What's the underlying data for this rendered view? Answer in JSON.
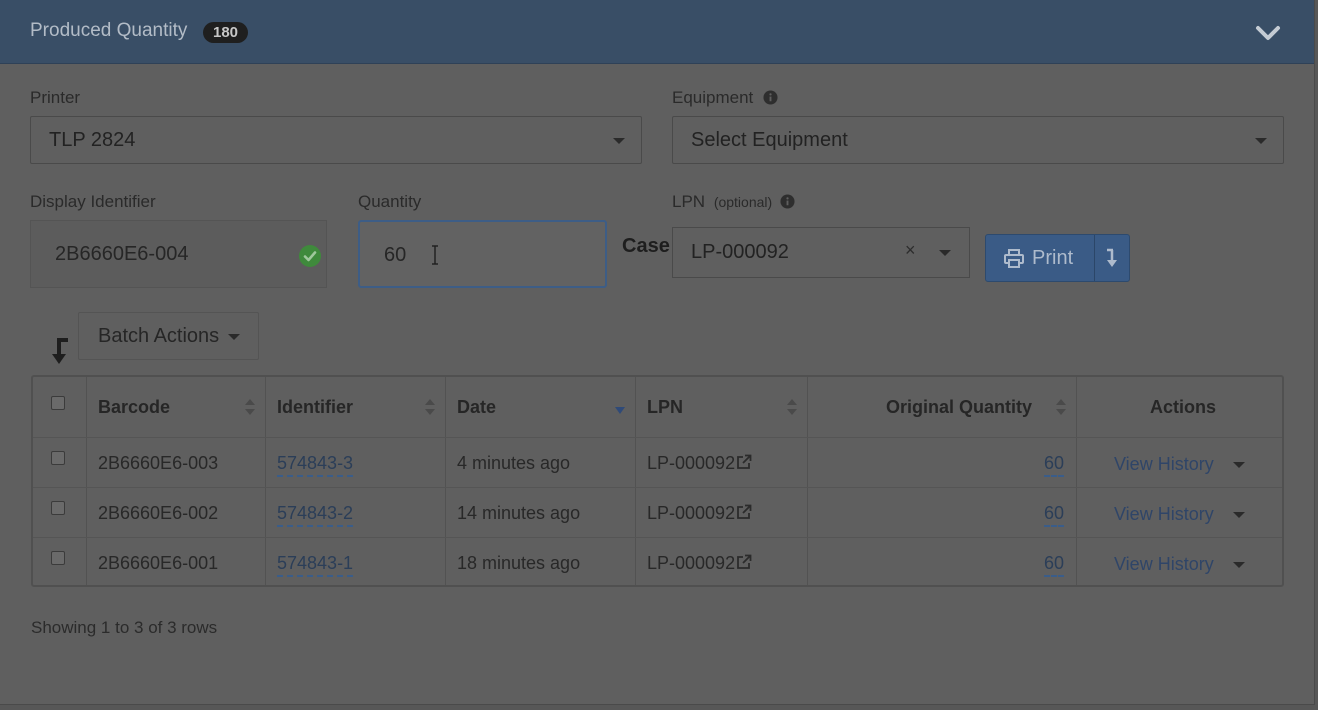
{
  "panel": {
    "title": "Produced Quantity",
    "badge": "180"
  },
  "form": {
    "printer_label": "Printer",
    "printer_value": "TLP 2824",
    "equipment_label": "Equipment",
    "equipment_value": "Select Equipment",
    "display_identifier_label": "Display Identifier",
    "display_identifier_value": "2B6660E6-004",
    "quantity_label": "Quantity",
    "quantity_value": "60",
    "unit_label": "Case",
    "lpn_label": "LPN",
    "lpn_optional": "(optional)",
    "lpn_value": "LP-000092",
    "lpn_clear": "×",
    "print_label": "Print"
  },
  "toolbar": {
    "batch_actions_label": "Batch Actions"
  },
  "table": {
    "columns": [
      "Barcode",
      "Identifier",
      "Date",
      "LPN",
      "Original Quantity",
      "Actions"
    ],
    "rows": [
      {
        "barcode": "2B6660E6-003",
        "identifier": "574843-3",
        "date": "4 minutes ago",
        "lpn": "LP-000092",
        "quantity": "60",
        "action": "View History"
      },
      {
        "barcode": "2B6660E6-002",
        "identifier": "574843-2",
        "date": "14 minutes ago",
        "lpn": "LP-000092",
        "quantity": "60",
        "action": "View History"
      },
      {
        "barcode": "2B6660E6-001",
        "identifier": "574843-1",
        "date": "18 minutes ago",
        "lpn": "LP-000092",
        "quantity": "60",
        "action": "View History"
      }
    ]
  },
  "footer": {
    "pagination_text": "Showing 1 to 3 of 3 rows"
  },
  "colors": {
    "header_bg": "#394e66",
    "primary_button": "#3a5b86",
    "link": "#2f4568",
    "success": "#3f8a3c",
    "overlay_bg": "#5f5f5f"
  },
  "icons": [
    "chevron-down-icon",
    "info-icon",
    "check-circle-icon",
    "text-cursor-icon",
    "close-icon",
    "caret-down-icon",
    "printer-icon",
    "download-icon",
    "batch-arrow-icon",
    "sort-icon",
    "external-link-icon"
  ]
}
